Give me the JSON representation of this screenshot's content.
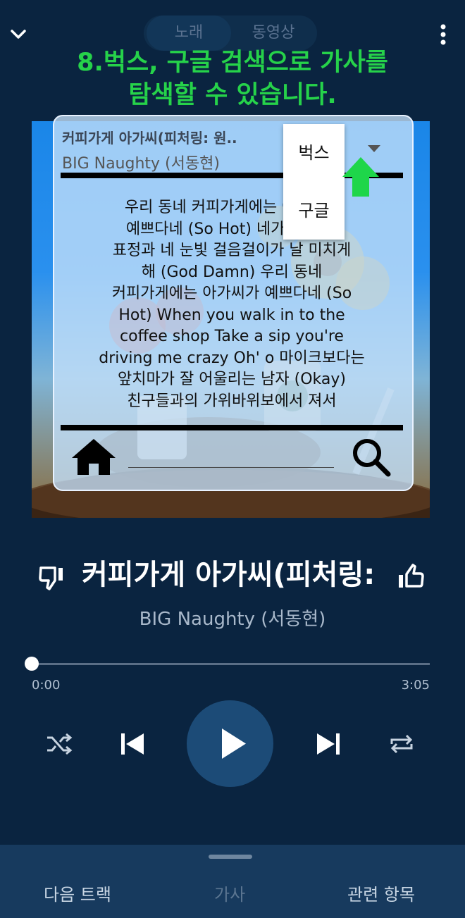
{
  "top": {
    "segment": [
      "노래",
      "동영상"
    ],
    "headline_lines": [
      "8.벅스, 구글 검색으로 가사를",
      "탐색할 수 있습니다."
    ]
  },
  "lyrics_card": {
    "song_title": "커피가게 아가씨(피처링: 원..",
    "artist": "BIG Naughty (서동현)",
    "lyrics_lines": [
      "우리 동네 커피가게에는 아가씨가",
      "예쁘다네 (So Hot) 네가 웃을 때",
      "표정과 네 눈빛 걸음걸이가 날 미치게",
      "해 (God Damn) 우리 동네",
      "커피가게에는 아가씨가 예쁘다네 (So",
      "Hot) When you walk in to the",
      "coffee shop Take a sip you're",
      "driving me crazy Oh' o 마이크보다는",
      "앞치마가 잘 어울리는 남자 (Okay)",
      "친구들과의 가위바위보에서 져서"
    ],
    "menu": [
      "벅스",
      "구글"
    ]
  },
  "player": {
    "title": "커피가게 아가씨(피처링: 원",
    "artist": "BIG Naughty (서동현)",
    "time_current": "0:00",
    "time_total": "3:05",
    "progress": 0.0
  },
  "tabs": [
    "다음 트랙",
    "가사",
    "관련 항목"
  ],
  "icons": [
    "chevron-down-icon",
    "more-vert-icon",
    "home-icon",
    "search-icon",
    "dropdown-caret-icon",
    "arrow-up-icon",
    "thumb-down-icon",
    "thumb-up-icon",
    "shuffle-icon",
    "skip-previous-icon",
    "play-icon",
    "skip-next-icon",
    "repeat-icon"
  ],
  "colors": {
    "background": "#0a2440",
    "headline": "#26d24a",
    "play_button": "#1c4b77",
    "sheet": "#173a5e"
  }
}
